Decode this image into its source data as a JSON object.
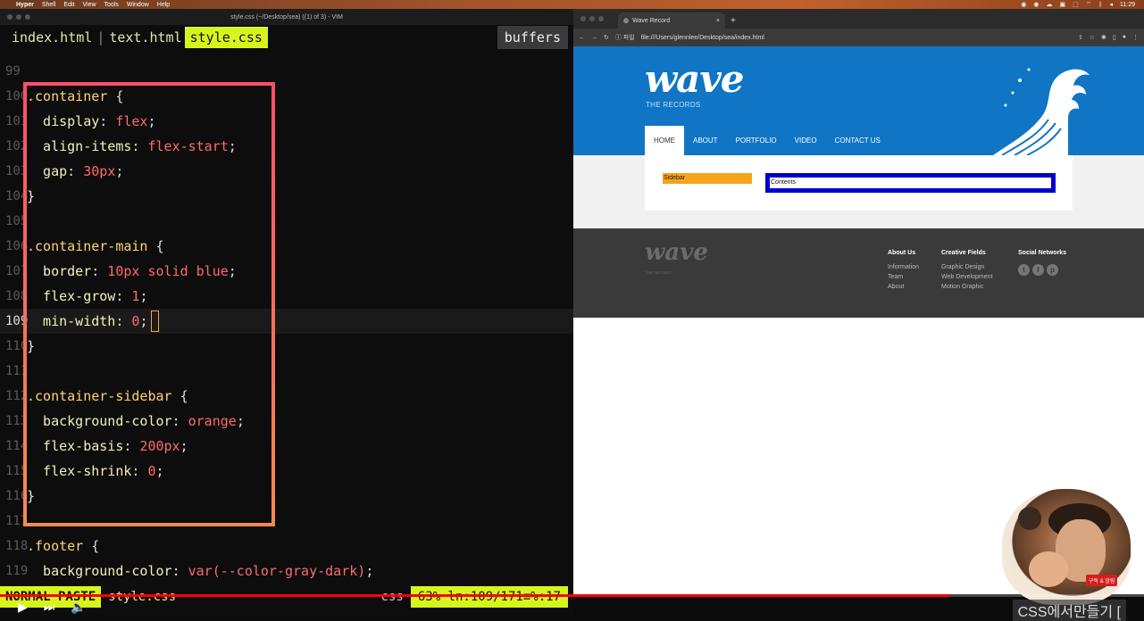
{
  "menubar": {
    "apple": "",
    "items": [
      "Hyper",
      "Shell",
      "Edit",
      "View",
      "Tools",
      "Window",
      "Help"
    ],
    "clock": "11:29"
  },
  "terminal": {
    "title": "style.css (~/Desktop/sea) ((1) of 3) - VIM",
    "tabs": [
      "index.html",
      "text.html",
      "style.css"
    ],
    "separator": "|",
    "active_tab": "style.css",
    "buffers_label": "buffers",
    "lines": [
      {
        "n": "99",
        "text": ""
      },
      {
        "n": "100",
        "text": ".container {"
      },
      {
        "n": "101",
        "text": "  display: flex;"
      },
      {
        "n": "102",
        "text": "  align-items: flex-start;"
      },
      {
        "n": "103",
        "text": "  gap: 30px;"
      },
      {
        "n": "104",
        "text": "}"
      },
      {
        "n": "105",
        "text": ""
      },
      {
        "n": "106",
        "text": ".container-main {"
      },
      {
        "n": "107",
        "text": "  border: 10px solid blue;"
      },
      {
        "n": "108",
        "text": "  flex-grow: 1;"
      },
      {
        "n": "109",
        "text": "  min-width: 0;"
      },
      {
        "n": "110",
        "text": "}"
      },
      {
        "n": "111",
        "text": ""
      },
      {
        "n": "112",
        "text": ".container-sidebar {"
      },
      {
        "n": "113",
        "text": "  background-color: orange;"
      },
      {
        "n": "114",
        "text": "  flex-basis: 200px;"
      },
      {
        "n": "115",
        "text": "  flex-shrink: 0;"
      },
      {
        "n": "116",
        "text": "}"
      },
      {
        "n": "117",
        "text": ""
      },
      {
        "n": "118",
        "text": ".footer {"
      },
      {
        "n": "119",
        "text": "  background-color: var(--color-gray-dark);"
      }
    ],
    "status": {
      "mode": "NORMAL  PASTE",
      "file": "style.css",
      "filetype": "css",
      "position": "63%  ln:109/171≡%:17"
    }
  },
  "browser": {
    "tab_title": "Wave Record",
    "tab_close": "×",
    "new_tab": "+",
    "url_prefix": "ⓘ 파일",
    "url": "file:///Users/glennlee/Desktop/sea/index.html",
    "page": {
      "logo": "wave",
      "subtitle": "THE RECORDS",
      "nav": [
        "HOME",
        "ABOUT",
        "PORTFOLIO",
        "VIDEO",
        "CONTACT US"
      ],
      "active_nav": "HOME",
      "sidebar_text": "Sidebar",
      "main_text": "Contents",
      "footer": {
        "logo": "wave",
        "subtitle": "THE RECORDS",
        "about_heading": "About Us",
        "about_items": [
          "Information",
          "Team",
          "About"
        ],
        "fields_heading": "Creative Fields",
        "fields_items": [
          "Graphic Design",
          "Web Development",
          "Motion Graphic"
        ],
        "social_heading": "Social Networks",
        "social_icons": [
          "t",
          "f",
          "p"
        ]
      }
    }
  },
  "video": {
    "progress_fraction": 0.83,
    "captions": "CSS에서만들기 [",
    "yt_badge": "구독 & 알림"
  },
  "colors": {
    "vim_accent": "#d7f51d",
    "wave_blue": "#1075c4",
    "sidebar_orange": "#f7a21b",
    "main_border_blue": "#0000cc",
    "highlight": "#f5577a"
  }
}
